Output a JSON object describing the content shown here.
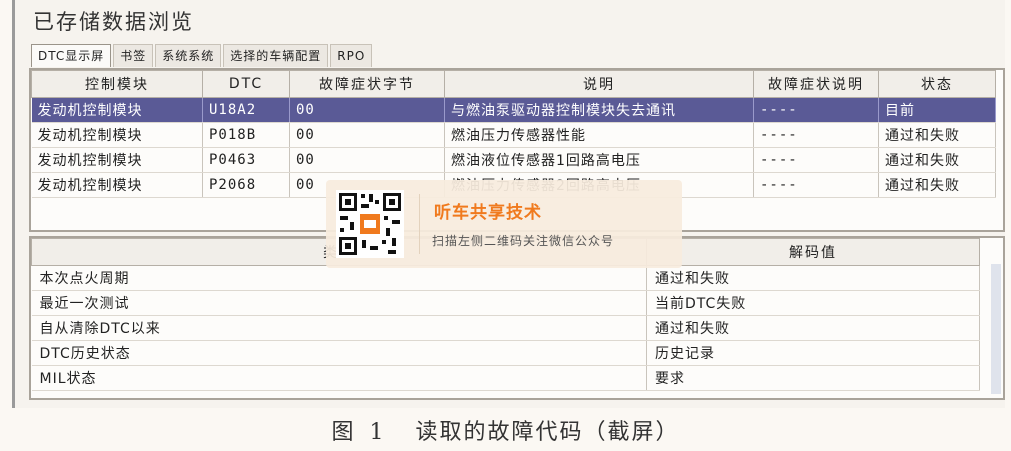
{
  "window": {
    "title": "已存储数据浏览"
  },
  "tabs": [
    {
      "label": "DTC显示屏",
      "active": true
    },
    {
      "label": "书签"
    },
    {
      "label": "系统系统"
    },
    {
      "label": "选择的车辆配置"
    },
    {
      "label": "RPO"
    }
  ],
  "dtc_table": {
    "headers": [
      "控制模块",
      "DTC",
      "故障症状字节",
      "说明",
      "故障症状说明",
      "状态"
    ],
    "rows": [
      {
        "module": "发动机控制模块",
        "dtc": "U18A2",
        "byte": "00",
        "desc": "与燃油泵驱动器控制模块失去通讯",
        "symptom": "----",
        "status": "目前",
        "selected": true
      },
      {
        "module": "发动机控制模块",
        "dtc": "P018B",
        "byte": "00",
        "desc": "燃油压力传感器性能",
        "symptom": "----",
        "status": "通过和失败"
      },
      {
        "module": "发动机控制模块",
        "dtc": "P0463",
        "byte": "00",
        "desc": "燃油液位传感器1回路高电压",
        "symptom": "----",
        "status": "通过和失败"
      },
      {
        "module": "发动机控制模块",
        "dtc": "P2068",
        "byte": "00",
        "desc": "燃油压力传感器2回路高电压",
        "symptom": "----",
        "status": "通过和失败"
      }
    ]
  },
  "detail_table": {
    "headers": [
      "类别",
      "解码值"
    ],
    "rows": [
      {
        "category": "本次点火周期",
        "value": "通过和失败"
      },
      {
        "category": "最近一次测试",
        "value": "当前DTC失败"
      },
      {
        "category": "自从清除DTC以来",
        "value": "通过和失败"
      },
      {
        "category": "DTC历史状态",
        "value": "历史记录"
      },
      {
        "category": "MIL状态",
        "value": "要求"
      }
    ]
  },
  "caption": {
    "fig": "图",
    "num": "1",
    "text": "读取的故障代码（截屏）"
  },
  "watermark": {
    "title": "听车共享技术",
    "subtitle": "扫描左侧二维码关注微信公众号"
  },
  "colors": {
    "selected_row": "#5a5a96",
    "watermark_title": "#f07a1e"
  }
}
